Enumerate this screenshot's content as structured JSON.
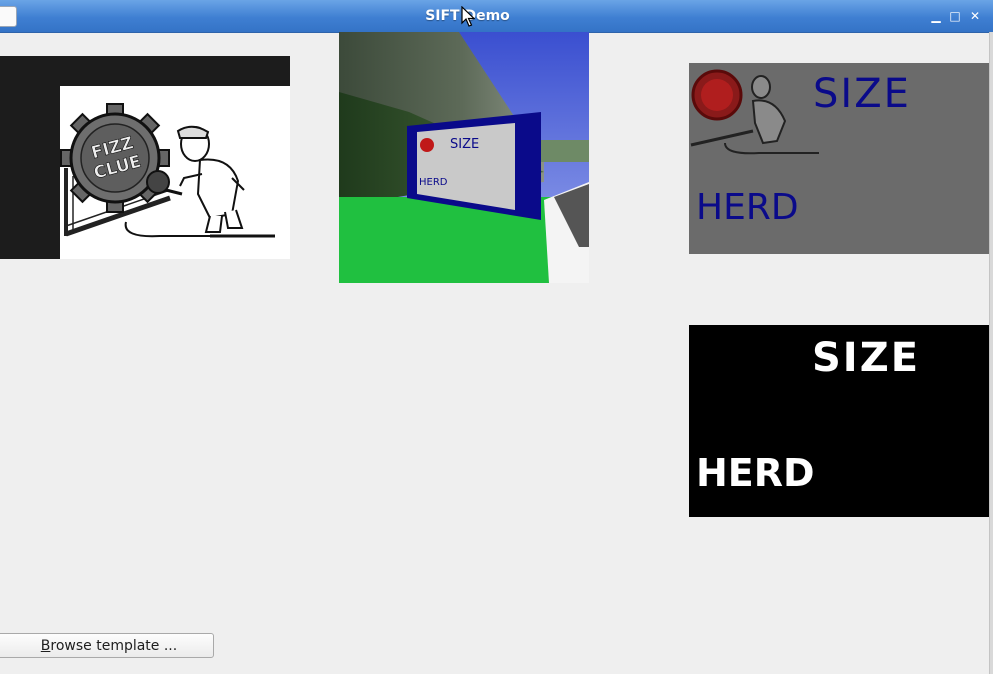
{
  "window": {
    "title": "SIFT Demo",
    "controls": {
      "minimize_glyph": "▁",
      "maximize_glyph": "□",
      "close_glyph": "✕"
    }
  },
  "template_image": {
    "logo_line1": "FIZZ",
    "logo_line2": "CLUE"
  },
  "scene_image": {
    "sign_size": "SIZE",
    "sign_herd": "HERD"
  },
  "rectified_image": {
    "size_text": "SIZE",
    "herd_text": "HERD"
  },
  "threshold_image": {
    "size_text": "SIZE",
    "herd_text": "HERD"
  },
  "controls": {
    "browse_mnemonic": "B",
    "browse_rest": "rowse template ..."
  },
  "colors": {
    "titlebar": "#3f7fd2",
    "sign_border": "#0a0a8a",
    "grass": "#20c040"
  }
}
